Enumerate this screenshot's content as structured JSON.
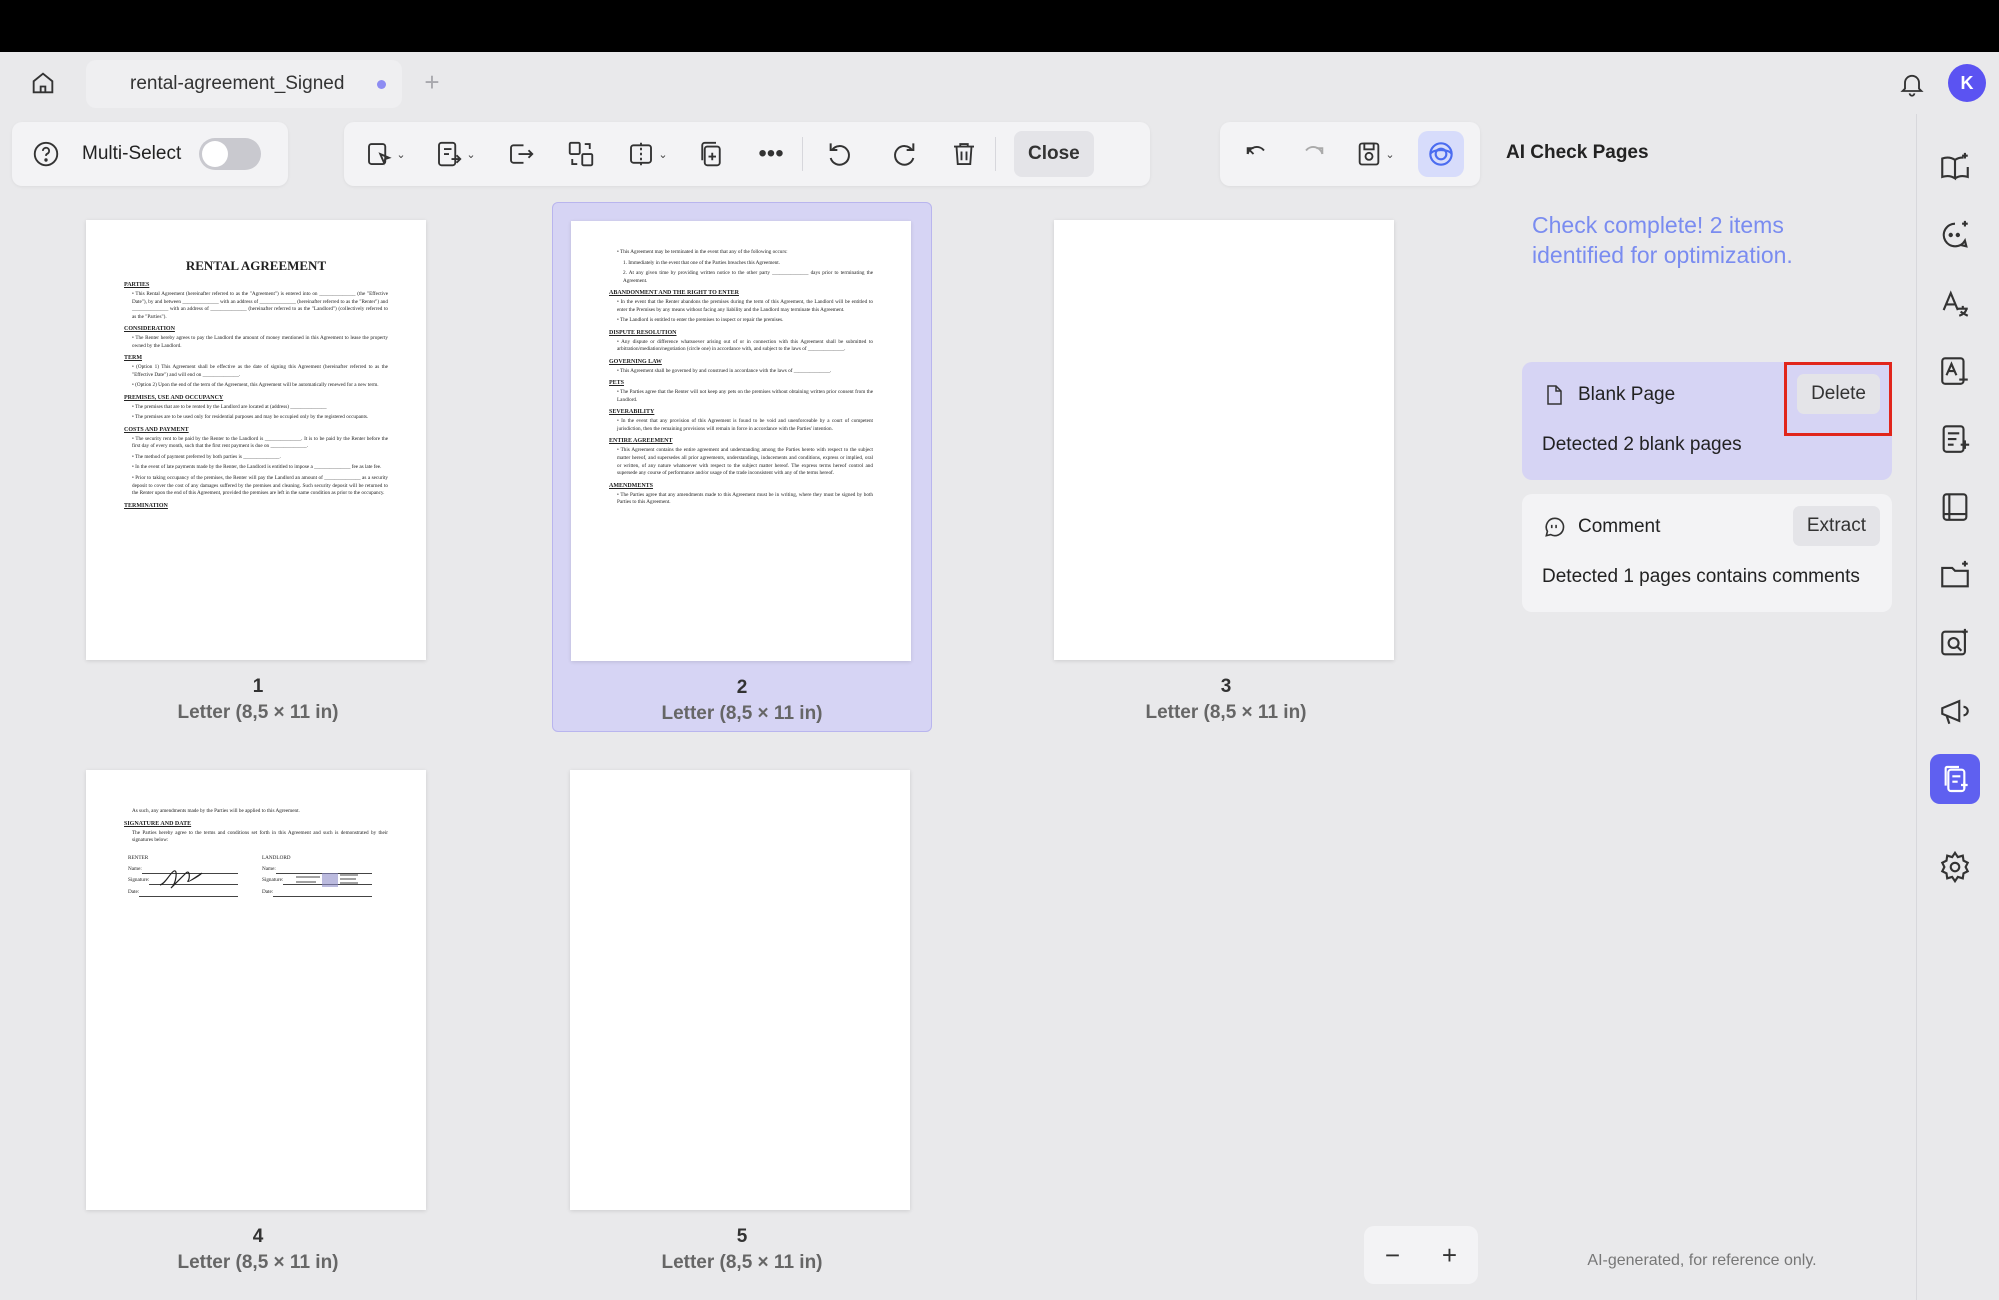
{
  "tabs": {
    "title": "rental-agreement_Signed",
    "new_tab": "+"
  },
  "user": {
    "initial": "K"
  },
  "toolbar": {
    "multi_select_label": "Multi-Select",
    "close_label": "Close"
  },
  "pages": [
    {
      "number": "1",
      "size": "Letter (8,5 × 11 in)"
    },
    {
      "number": "2",
      "size": "Letter (8,5 × 11 in)"
    },
    {
      "number": "3",
      "size": "Letter (8,5 × 11 in)"
    },
    {
      "number": "4",
      "size": "Letter (8,5 × 11 in)"
    },
    {
      "number": "5",
      "size": "Letter (8,5 × 11 in)"
    }
  ],
  "page1": {
    "title": "RENTAL AGREEMENT",
    "sections": [
      "PARTIES",
      "CONSIDERATION",
      "TERM",
      "PREMISES, USE AND OCCUPANCY",
      "COSTS AND PAYMENT",
      "TERMINATION"
    ]
  },
  "page2": {
    "sections": [
      "ABANDONMENT AND THE RIGHT TO ENTER",
      "DISPUTE RESOLUTION",
      "GOVERNING LAW",
      "PETS",
      "SEVERABILITY",
      "ENTIRE AGREEMENT",
      "AMENDMENTS"
    ]
  },
  "page4": {
    "line1": "As such, any amendments made by the Parties will be applied to this Agreement.",
    "section": "SIGNATURE AND DATE",
    "line2": "The Parties hereby agree to the terms and conditions set forth in this Agreement and such is demonstrated by their signatures below:",
    "renter": "RENTER",
    "landlord": "LANDLORD",
    "name": "Name:",
    "signature": "Signature:",
    "date": "Date:"
  },
  "zoom": {
    "minus": "−",
    "plus": "+"
  },
  "ai_panel": {
    "title": "AI Check Pages",
    "status": "Check complete! 2 items identified for optimization.",
    "results": [
      {
        "title": "Blank Page",
        "action": "Delete",
        "description": "Detected 2 blank pages"
      },
      {
        "title": "Comment",
        "action": "Extract",
        "description": "Detected 1 pages contains comments"
      }
    ],
    "footer": "AI-generated, for reference only."
  },
  "colors": {
    "accent": "#5f60f0",
    "selected_bg": "#d6d4f4",
    "status_text": "#7a8cf0",
    "highlight": "#e1251b"
  }
}
